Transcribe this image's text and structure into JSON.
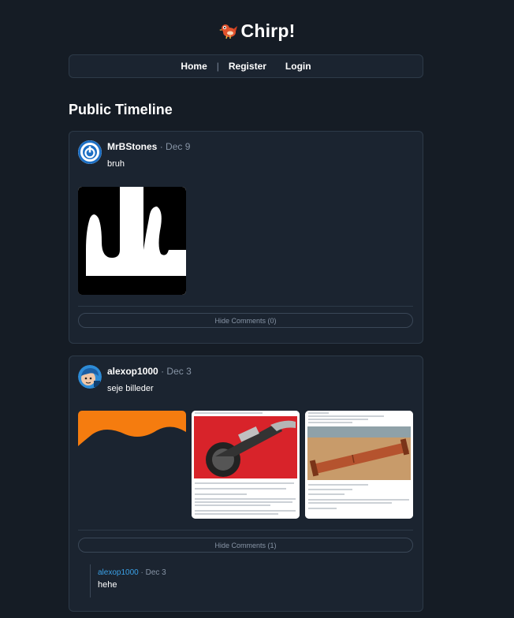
{
  "brand": {
    "name": "Chirp!"
  },
  "nav": {
    "home": "Home",
    "separator": "|",
    "register": "Register",
    "login": "Login"
  },
  "page": {
    "title": "Public Timeline"
  },
  "posts": [
    {
      "author": "MrBStones",
      "date": "Dec 9",
      "dot": "·",
      "text": "bruh",
      "comments_label": "Hide Comments (0)"
    },
    {
      "author": "alexop1000",
      "date": "Dec 3",
      "dot": "·",
      "text": "seje billeder",
      "comments_label": "Hide Comments (1)",
      "comments": [
        {
          "author": "alexop1000",
          "dot": "·",
          "date": "Dec 3",
          "text": "hehe"
        }
      ]
    }
  ],
  "colors": {
    "accent": "#3aa0e6",
    "background": "#151c25",
    "card": "#1b2430",
    "orange": "#f57c0f"
  }
}
